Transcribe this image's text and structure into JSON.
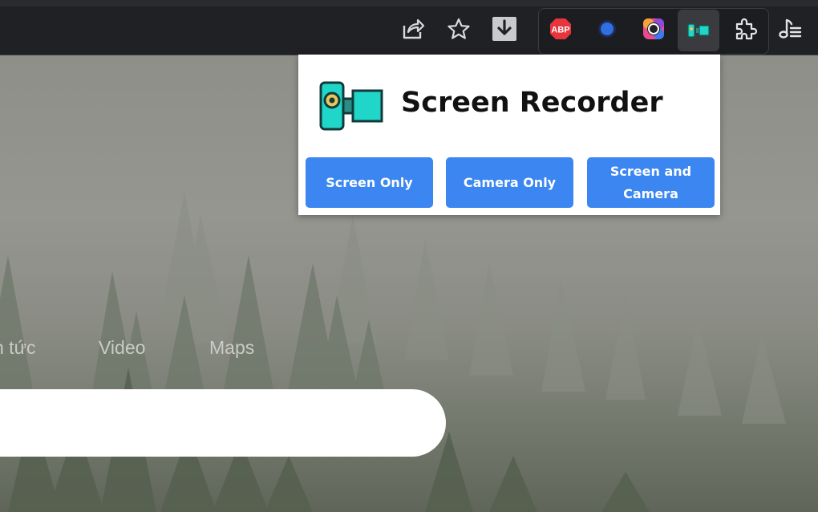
{
  "toolbar": {
    "icons": [
      "share-icon",
      "bookmark-star-icon",
      "download-icon"
    ],
    "extensions": [
      "adblock-plus-icon",
      "blue-dot-extension-icon",
      "color-ring-extension-icon",
      "screen-recorder-extension-icon",
      "extensions-puzzle-icon",
      "reading-list-icon"
    ],
    "abp_text": "ABP"
  },
  "popup": {
    "title": "Screen Recorder",
    "buttons": {
      "screen_only": "Screen Only",
      "camera_only": "Camera Only",
      "screen_and_camera_line1": "Screen and",
      "screen_and_camera_line2": "Camera"
    },
    "accent": "#3b86f0",
    "icon_color": "#1fd6c8"
  },
  "page": {
    "nav": [
      "n tức",
      "Video",
      "Maps"
    ],
    "search_value": ""
  }
}
